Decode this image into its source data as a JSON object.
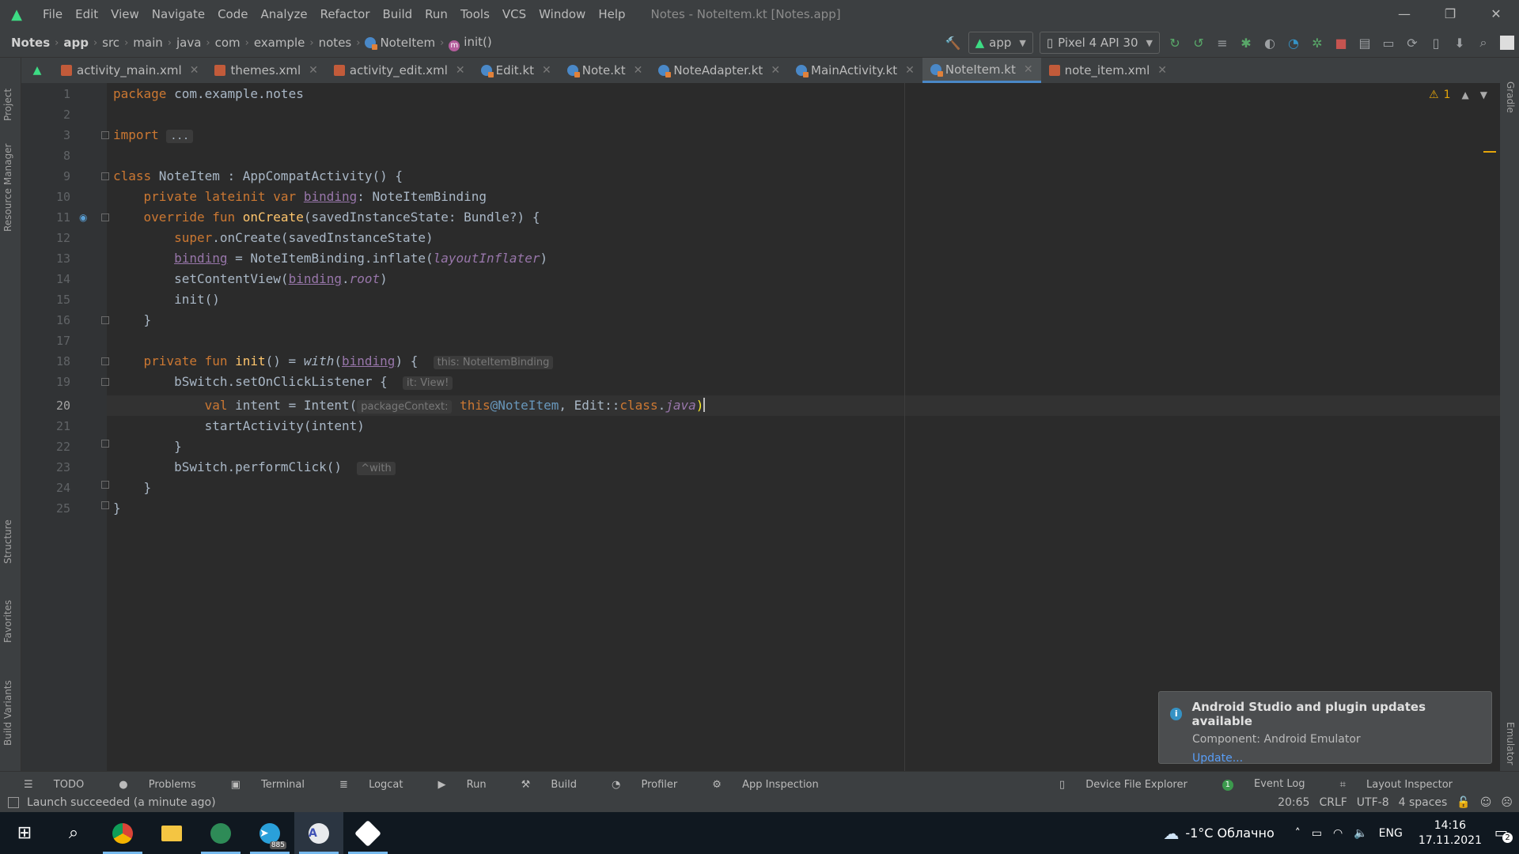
{
  "titlebar": {
    "menu": [
      "File",
      "Edit",
      "View",
      "Navigate",
      "Code",
      "Analyze",
      "Refactor",
      "Build",
      "Run",
      "Tools",
      "VCS",
      "Window",
      "Help"
    ],
    "window_title": "Notes - NoteItem.kt [Notes.app]"
  },
  "breadcrumbs": [
    "Notes",
    "app",
    "src",
    "main",
    "java",
    "com",
    "example",
    "notes",
    "NoteItem",
    "init()"
  ],
  "toolbar": {
    "run_config": "app",
    "device": "Pixel 4 API 30"
  },
  "tabs": [
    {
      "label": "activity_main.xml",
      "type": "xml"
    },
    {
      "label": "themes.xml",
      "type": "xml"
    },
    {
      "label": "activity_edit.xml",
      "type": "xml"
    },
    {
      "label": "Edit.kt",
      "type": "kt"
    },
    {
      "label": "Note.kt",
      "type": "kt"
    },
    {
      "label": "NoteAdapter.kt",
      "type": "kt"
    },
    {
      "label": "MainActivity.kt",
      "type": "kt"
    },
    {
      "label": "NoteItem.kt",
      "type": "kt",
      "active": true
    },
    {
      "label": "note_item.xml",
      "type": "xml"
    }
  ],
  "editor": {
    "line_numbers": [
      "1",
      "2",
      "3",
      "8",
      "9",
      "10",
      "11",
      "12",
      "13",
      "14",
      "15",
      "16",
      "17",
      "18",
      "19",
      "20",
      "21",
      "22",
      "23",
      "24",
      "25"
    ],
    "current_line": "20",
    "warnings_count": "1",
    "hints": {
      "this": "this: NoteItemBinding",
      "it": "it: View!",
      "package_context": "packageContext:",
      "with": "^with"
    },
    "code_text": {
      "package": "package",
      "package_name": " com.example.notes",
      "import": "import",
      "import_folded": "...",
      "class_kw": "class",
      "class_decl": " NoteItem : AppCompatActivity() {",
      "line10_kw": "private lateinit var ",
      "binding": "binding",
      "line10_type": ": NoteItemBinding",
      "override_fun": "override fun ",
      "onCreate": "onCreate",
      "oncreate_params": "(savedInstanceState: Bundle?) {",
      "super": "super",
      "super_call": ".onCreate(savedInstanceState)",
      "inflate_call": " = NoteItemBinding.inflate(",
      "layoutInflater": "layoutInflater",
      "close_paren": ")",
      "setContentView": "setContentView(",
      "dot": ".",
      "root": "root",
      "init_call": "init()",
      "close_brace": "}",
      "private_fun": "private fun ",
      "init_name": "init",
      "init_sig": "() = ",
      "with": "with",
      "open_paren": "(",
      "brace_open": ") {",
      "bswitch_listener": "bSwitch.setOnClickListener {",
      "val_kw": "val",
      "intent_decl": " intent = Intent(",
      "this_kw": "this",
      "this_label": "@NoteItem",
      "edit_class": ", Edit::",
      "class_kw2": "class",
      "java": "java",
      "start_activity": "startActivity(intent)",
      "perform_click": "bSwitch.performClick()"
    }
  },
  "left_tools": [
    "Project",
    "Resource Manager",
    "Structure",
    "Favorites",
    "Build Variants"
  ],
  "right_tools": [
    "Gradle",
    "Emulator"
  ],
  "bottom_tools": [
    "TODO",
    "Problems",
    "Terminal",
    "Logcat",
    "Run",
    "Build",
    "Profiler",
    "App Inspection"
  ],
  "bottom_tools_right": [
    "Device File Explorer",
    "Event Log",
    "Layout Inspector"
  ],
  "event_log_count": "1",
  "status": {
    "message": "Launch succeeded (a minute ago)",
    "position": "20:65",
    "line_sep": "CRLF",
    "encoding": "UTF-8",
    "indent": "4 spaces"
  },
  "notification": {
    "title": "Android Studio and plugin updates available",
    "body": "Component: Android Emulator",
    "link": "Update..."
  },
  "taskbar": {
    "weather": "-1°C Облачно",
    "lang": "ENG",
    "time": "14:16",
    "date": "17.11.2021",
    "notif_count": "2",
    "telegram_badge": "885"
  }
}
